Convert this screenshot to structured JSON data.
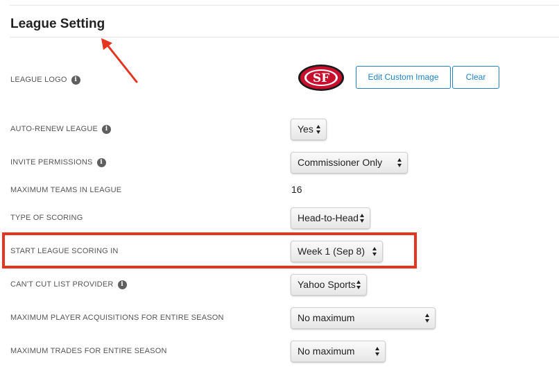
{
  "section": {
    "title": "League Setting"
  },
  "logo": {
    "label": "LEAGUE LOGO",
    "image_text": "SF",
    "edit_button": "Edit Custom Image",
    "clear_button": "Clear"
  },
  "rows": {
    "auto_renew": {
      "label": "AUTO-RENEW LEAGUE",
      "value": "Yes"
    },
    "invite_permissions": {
      "label": "INVITE PERMISSIONS",
      "value": "Commissioner Only"
    },
    "max_teams": {
      "label": "MAXIMUM TEAMS IN LEAGUE",
      "value": "16"
    },
    "scoring_type": {
      "label": "TYPE OF SCORING",
      "value": "Head-to-Head"
    },
    "start_scoring": {
      "label": "START LEAGUE SCORING IN",
      "value": "Week 1 (Sep 8)"
    },
    "cant_cut": {
      "label": "CAN'T CUT LIST PROVIDER",
      "value": "Yahoo Sports"
    },
    "max_acquisitions": {
      "label": "MAXIMUM PLAYER ACQUISITIONS FOR ENTIRE SEASON",
      "value": "No maximum"
    },
    "max_trades": {
      "label": "MAXIMUM TRADES FOR ENTIRE SEASON",
      "value": "No maximum"
    }
  },
  "icons": {
    "info": "info-icon",
    "select_arrows": "select-arrows-icon"
  },
  "colors": {
    "accent": "#1f83c6",
    "annotation": "#e5341f",
    "logo_red": "#c8102e"
  }
}
